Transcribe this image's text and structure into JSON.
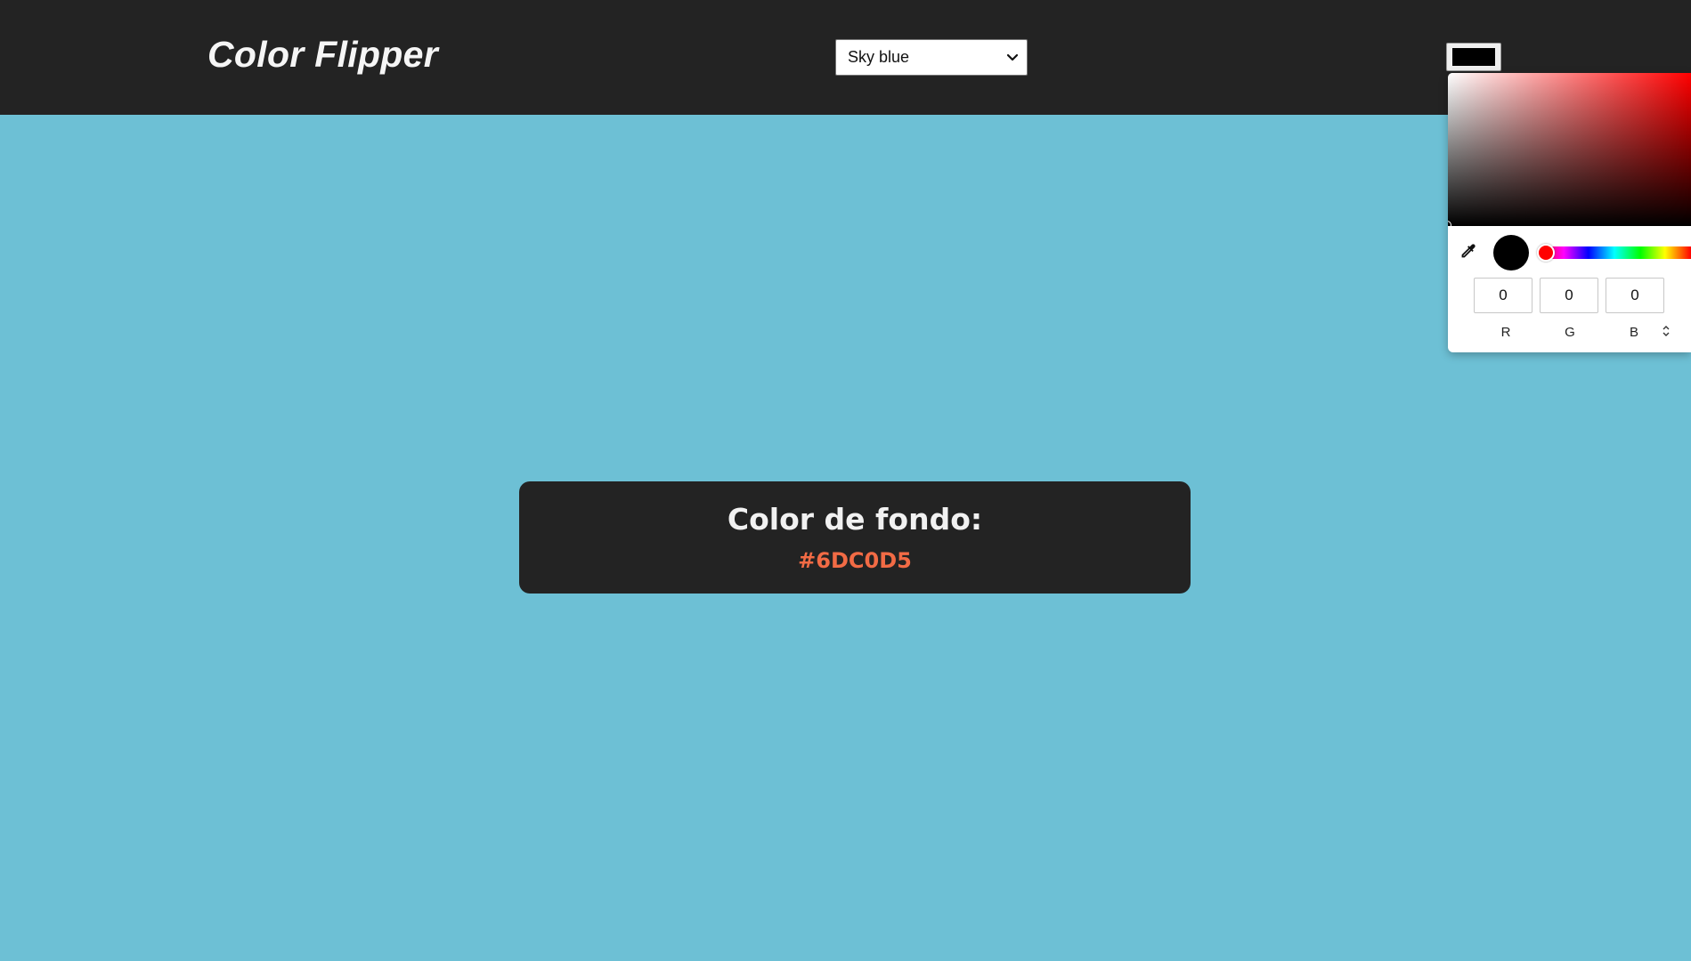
{
  "app": {
    "title": "Color Flipper",
    "background_color": "#6DC0D5"
  },
  "navbar": {
    "brand": "Color Flipper",
    "color_select": {
      "selected": "Sky blue"
    },
    "color_input": {
      "value": "#000000"
    }
  },
  "color_picker": {
    "rgb": [
      {
        "label": "R",
        "value": "0"
      },
      {
        "label": "G",
        "value": "0"
      },
      {
        "label": "B",
        "value": "0"
      }
    ],
    "hue_color": "#FF0000",
    "preview_color": "#000000",
    "icons": {
      "eyedropper": "eyedropper-icon",
      "mode_toggle": "up-down-arrows-icon"
    }
  },
  "info_card": {
    "title": "Color de fondo:",
    "value": "#6DC0D5",
    "value_color": "#F26B45"
  }
}
